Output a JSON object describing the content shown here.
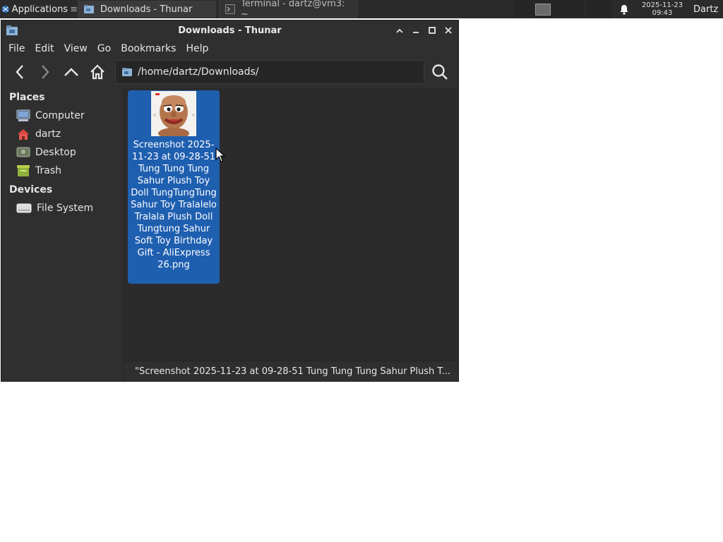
{
  "panel": {
    "applications_label": "Applications",
    "tasks": [
      {
        "label": "Downloads - Thunar",
        "active": true
      },
      {
        "label": "Terminal - dartz@vm3: ~",
        "active": false
      }
    ],
    "clock_date": "2025-11-23",
    "clock_time": "09:43",
    "user": "Dartz"
  },
  "window": {
    "title": "Downloads - Thunar",
    "menu": [
      "File",
      "Edit",
      "View",
      "Go",
      "Bookmarks",
      "Help"
    ],
    "location_path": "/home/dartz/Downloads/",
    "sidebar": {
      "places_heading": "Places",
      "places": [
        "Computer",
        "dartz",
        "Desktop",
        "Trash"
      ],
      "devices_heading": "Devices",
      "devices": [
        "File System"
      ]
    },
    "files": [
      {
        "name": "Screenshot 2025-11-23 at 09-28-51 Tung Tung Tung Sahur Plush Toy Doll TungTungTung Sahur Toy Tralalelo Tralala Plush Doll Tungtung Sahur Soft Toy Birthday Gift - AliExpress 26.png",
        "selected": true
      }
    ],
    "status": "\"Screenshot 2025-11-23 at 09-28-51 Tung Tung Tung Sahur Plush T..."
  },
  "colors": {
    "selection": "#1f5fb0",
    "panel_bg": "#2b2b2b",
    "window_bg": "#2f2f2f"
  }
}
